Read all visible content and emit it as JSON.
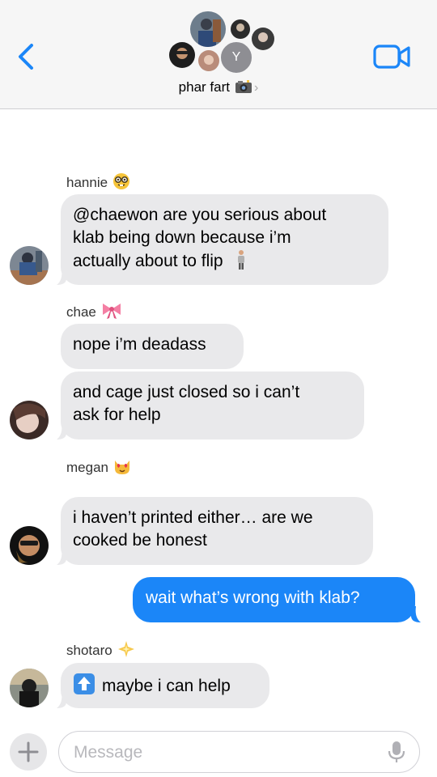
{
  "header": {
    "group_name": "phar fart",
    "avatar_initial": "Y",
    "back_icon": "chevron-left-icon",
    "video_icon": "video-camera-icon"
  },
  "messages": [
    {
      "sender": "hannie",
      "sender_emoji": "nerd-face",
      "direction": "incoming",
      "lines": [
        "@chaewon are you serious about",
        "klab being down because i’m",
        "actually about to flip"
      ],
      "trailing_emoji": "person-standing"
    },
    {
      "sender": "chae",
      "sender_emoji": "ribbon",
      "direction": "incoming",
      "lines": [
        "nope i’m deadass"
      ]
    },
    {
      "sender": "",
      "direction": "incoming",
      "lines": [
        "and cage just closed so i can’t",
        "ask for help"
      ]
    },
    {
      "sender": "megan",
      "sender_emoji": "cat-with-heart-eyes",
      "direction": "incoming",
      "lines": [
        "i haven’t printed either… are we",
        "cooked be honest"
      ]
    },
    {
      "sender": "",
      "direction": "outgoing",
      "lines": [
        "wait what’s wrong with klab?"
      ]
    },
    {
      "sender": "shotaro",
      "sender_emoji": "sparkle-star",
      "direction": "incoming",
      "leading_emoji": "up-arrow-button",
      "lines": [
        "maybe i can help"
      ]
    }
  ],
  "composer": {
    "placeholder": "Message",
    "plus_icon": "plus-icon",
    "mic_icon": "microphone-icon"
  },
  "colors": {
    "incoming_bubble": "#e9e9eb",
    "outgoing_bubble": "#1b86f8",
    "accent": "#1b86f8",
    "header_bg": "#f6f6f6"
  }
}
